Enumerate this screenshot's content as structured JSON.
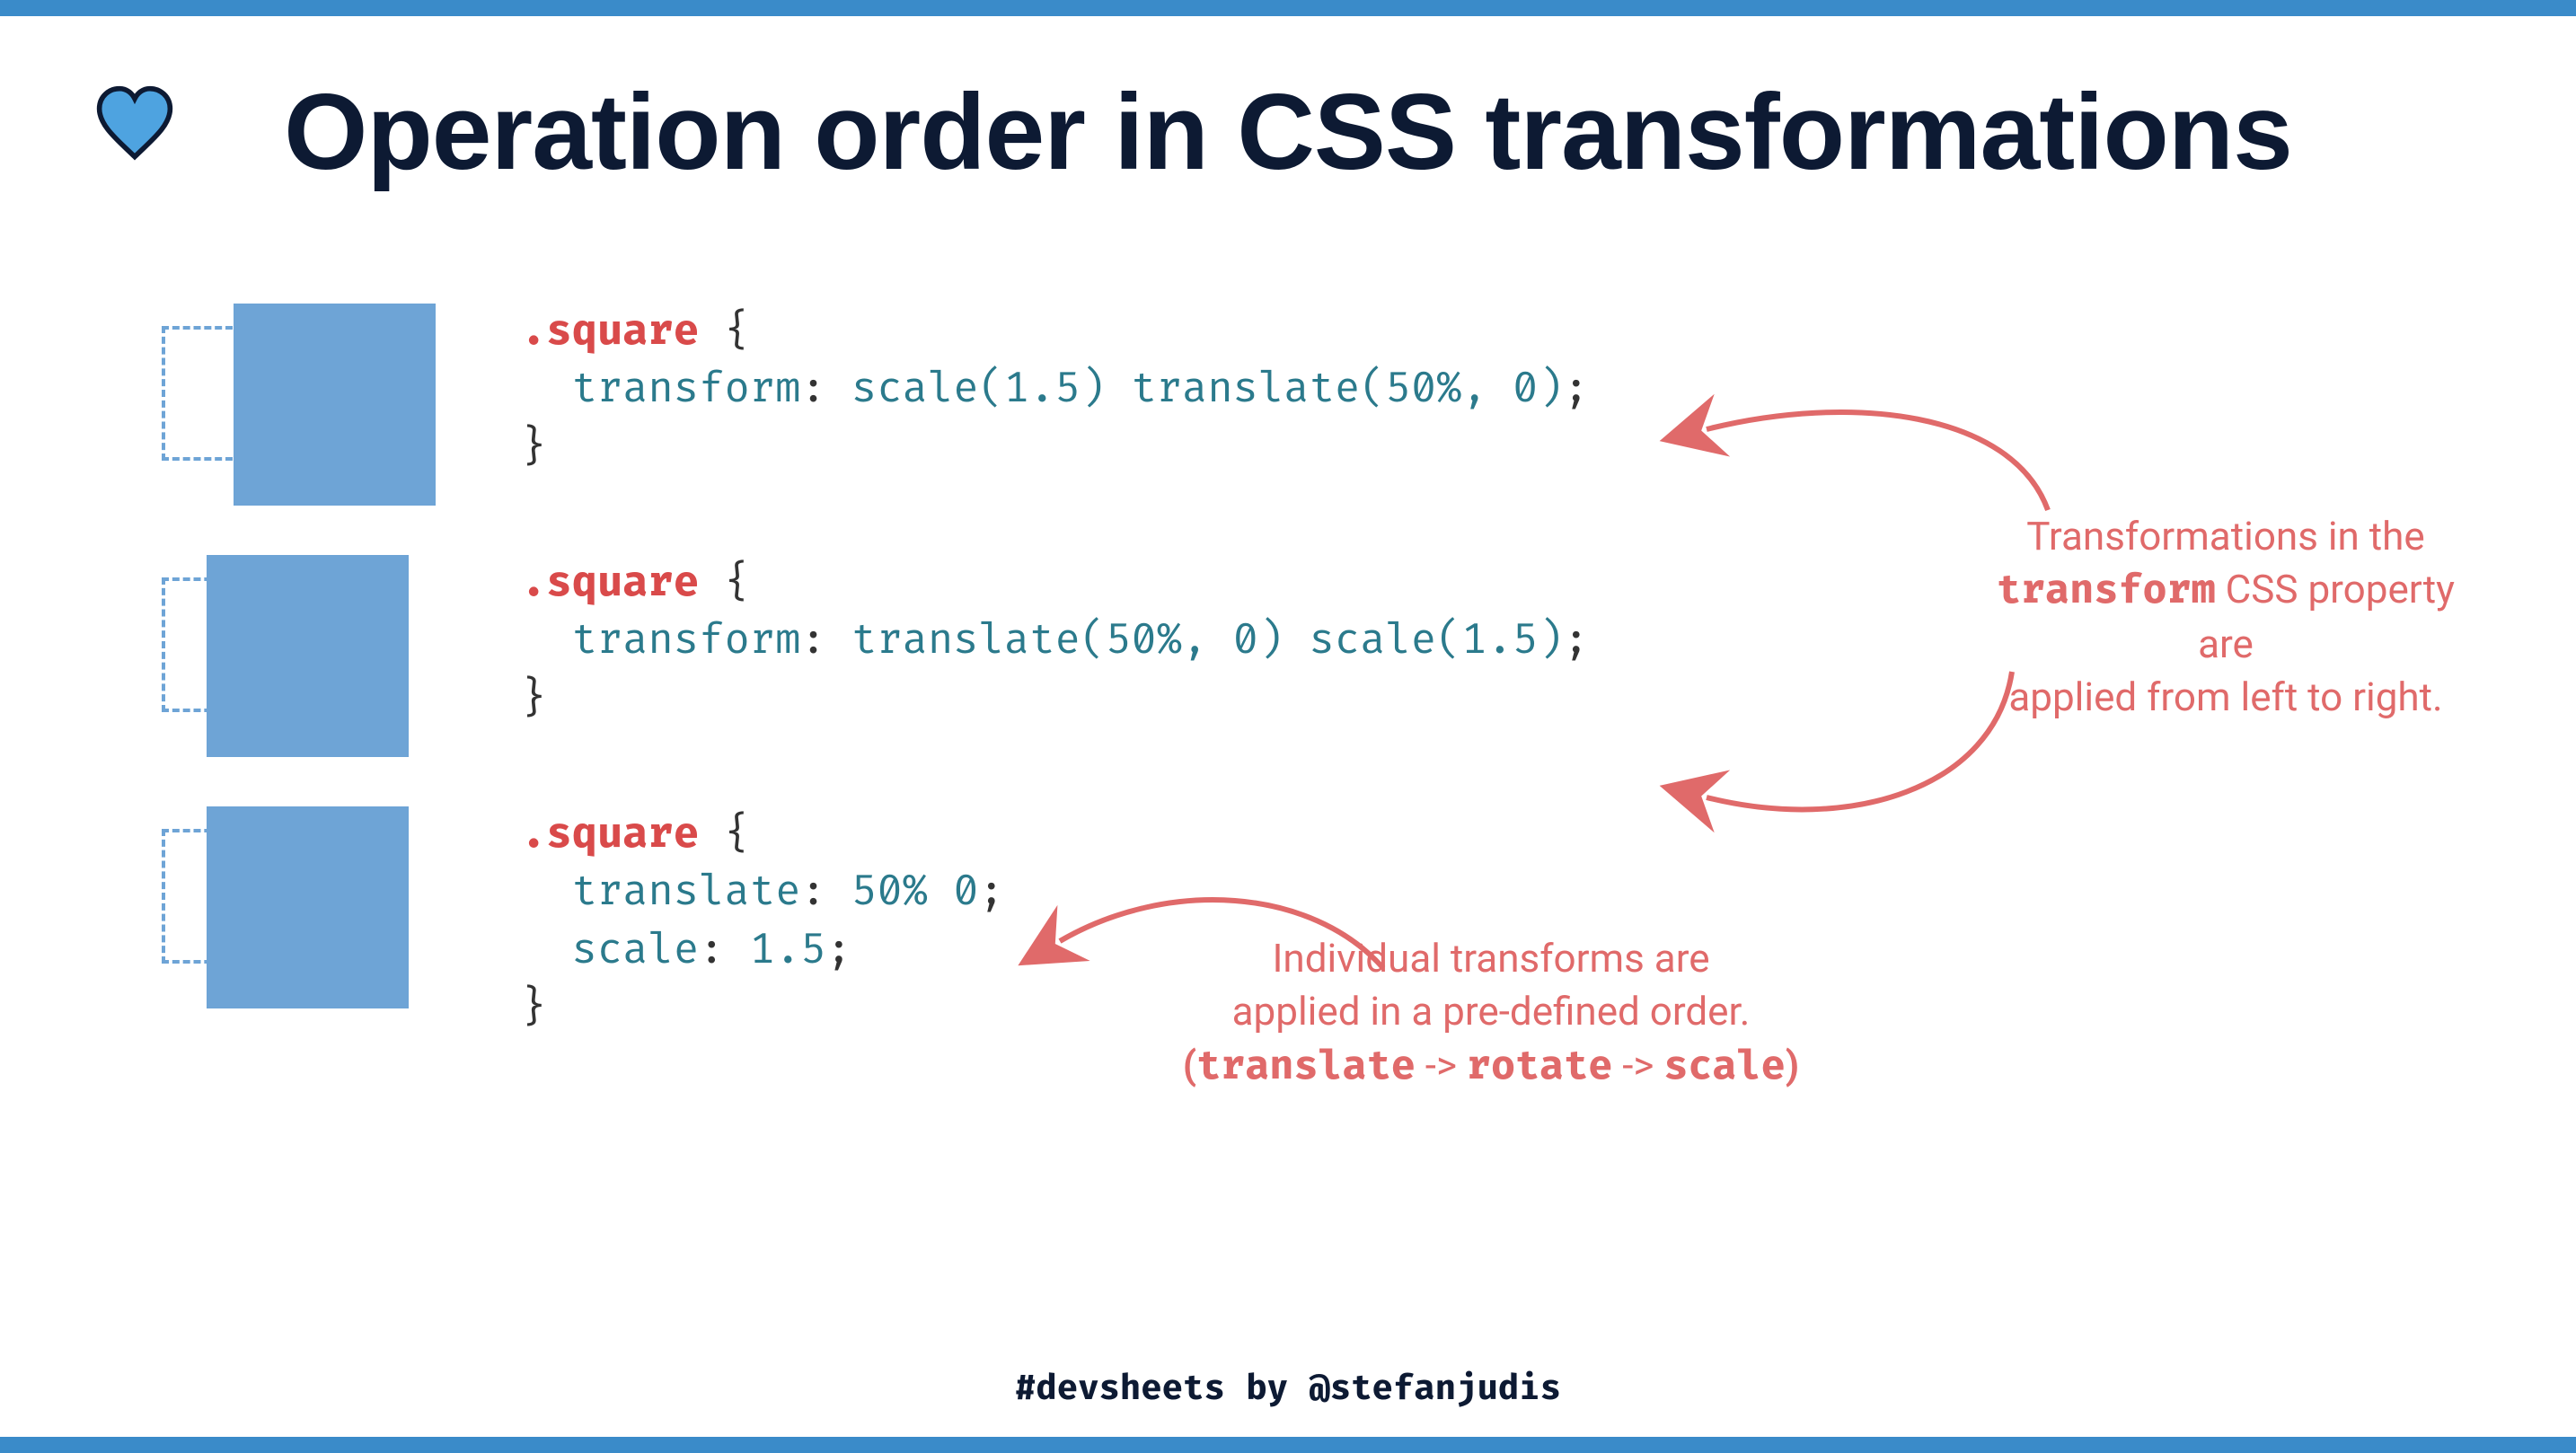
{
  "title": "Operation order in CSS transformations",
  "code1": {
    "selector": ".square",
    "prop": "transform",
    "value_parts": [
      "scale(1.5)",
      "translate(50%, 0)"
    ]
  },
  "code2": {
    "selector": ".square",
    "prop": "transform",
    "value_parts": [
      "translate(50%, 0)",
      "scale(1.5)"
    ]
  },
  "code3": {
    "selector": ".square",
    "lines": [
      {
        "prop": "translate",
        "val": "50% 0"
      },
      {
        "prop": "scale",
        "val": "1.5"
      }
    ]
  },
  "annotation1": {
    "line1": "Transformations in the",
    "code": "transform",
    "line2": " CSS property are",
    "line3": "applied from left to right."
  },
  "annotation2": {
    "line1": "Individual transforms are",
    "line2": "applied in a pre-defined order.",
    "paren_open": "(",
    "w1": "translate",
    "arrow1": " -> ",
    "w2": "rotate",
    "arrow2": " -> ",
    "w3": "scale",
    "paren_close": ")"
  },
  "footer": {
    "hashtag": "#devsheets",
    "by": " by ",
    "handle": "@stefanjudis"
  }
}
